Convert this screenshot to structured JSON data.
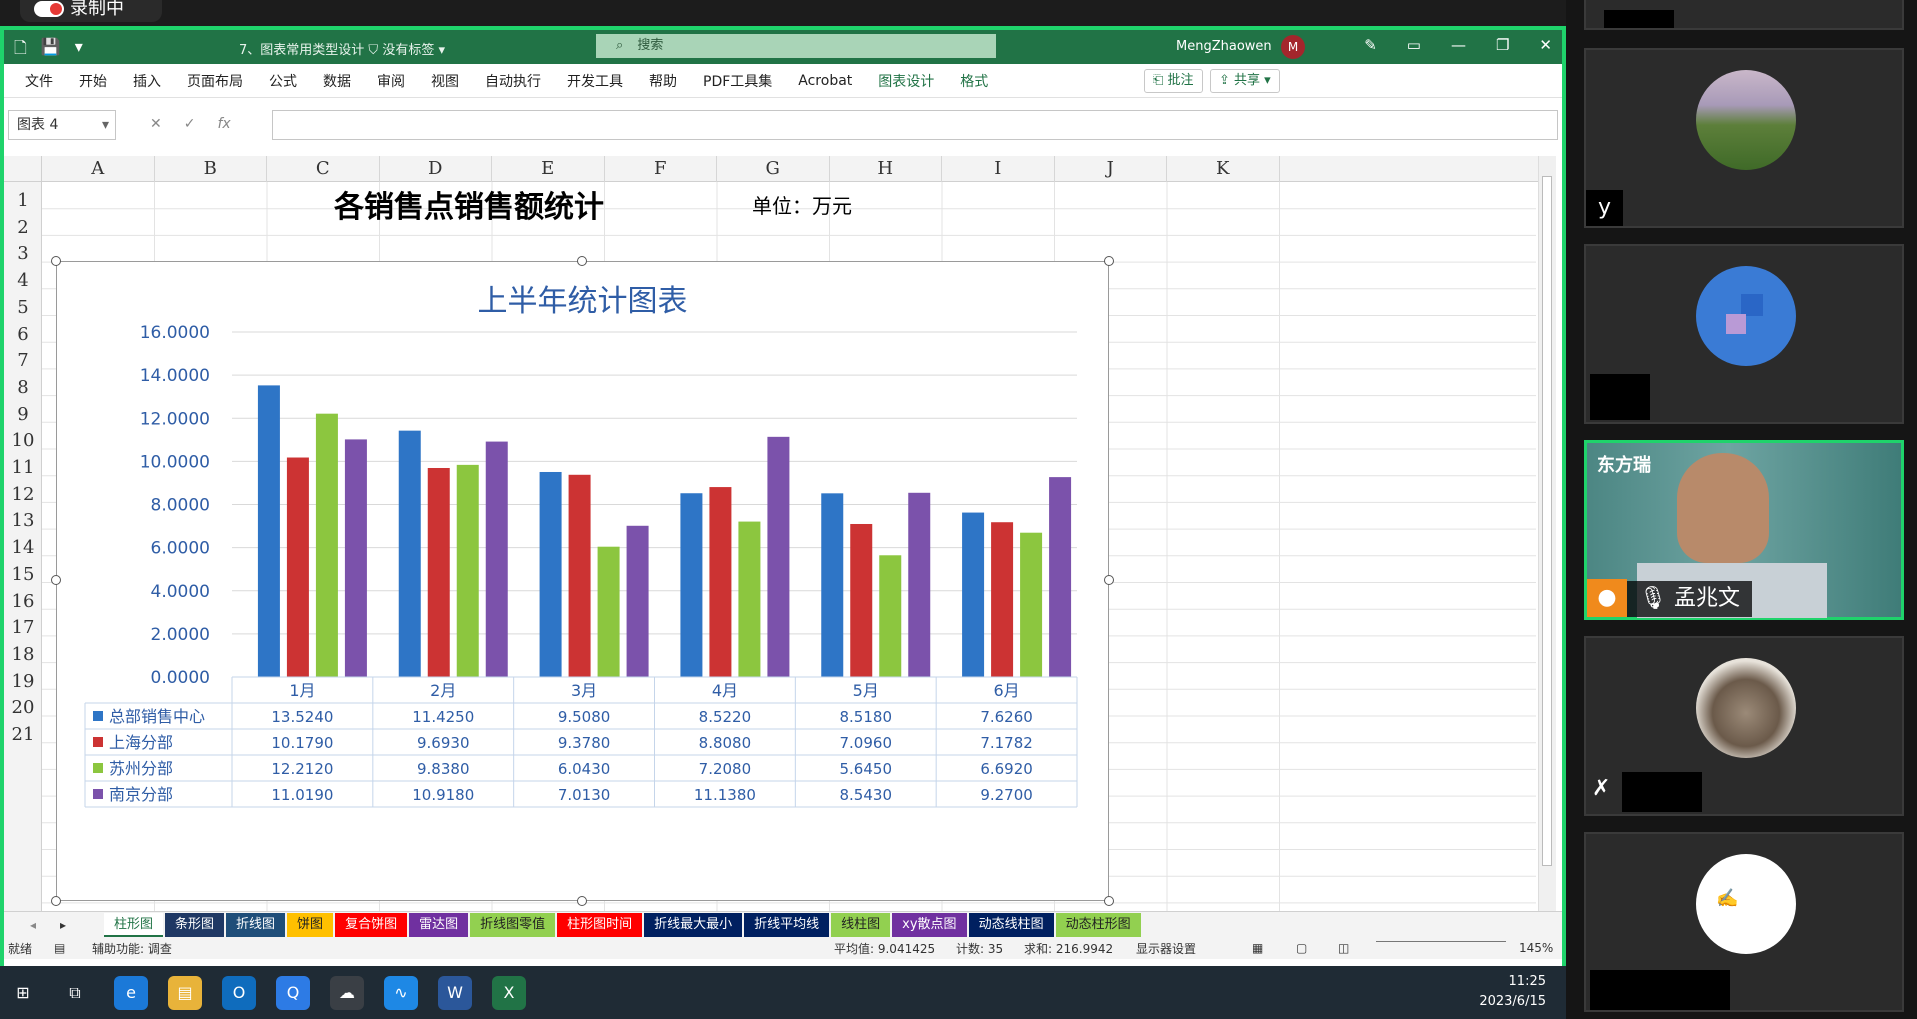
{
  "recording": {
    "label": "录制中"
  },
  "excel": {
    "doc_title": "7、图表常用类型设计",
    "label_status": "没有标签",
    "search_placeholder": "搜索",
    "user_name": "MengZhaowen",
    "user_initial": "M",
    "ribbon_tabs": [
      "文件",
      "开始",
      "插入",
      "页面布局",
      "公式",
      "数据",
      "审阅",
      "视图",
      "自动执行",
      "开发工具",
      "帮助",
      "PDF工具集",
      "Acrobat",
      "图表设计",
      "格式"
    ],
    "comment_btn": "批注",
    "share_btn": "共享",
    "name_box": "图表 4",
    "fx_label": "fx",
    "columns": [
      "A",
      "B",
      "C",
      "D",
      "E",
      "F",
      "G",
      "H",
      "I",
      "J",
      "K"
    ],
    "rows": [
      "1",
      "2",
      "3",
      "4",
      "5",
      "6",
      "7",
      "8",
      "9",
      "10",
      "11",
      "12",
      "13",
      "14",
      "15",
      "16",
      "17",
      "18",
      "19",
      "20",
      "21"
    ],
    "sheet_title": "各销售点销售额统计",
    "unit_label": "单位：万元",
    "sheet_tabs": [
      {
        "label": "柱形图",
        "color": "#ffffff"
      },
      {
        "label": "条形图",
        "color": "#1f3864"
      },
      {
        "label": "折线图",
        "color": "#1f4e79"
      },
      {
        "label": "饼图",
        "color": "#ffc000"
      },
      {
        "label": "复合饼图",
        "color": "#ff0000"
      },
      {
        "label": "雷达图",
        "color": "#7030a0"
      },
      {
        "label": "折线图零值",
        "color": "#92d050"
      },
      {
        "label": "柱形图时间",
        "color": "#ff0000"
      },
      {
        "label": "折线最大最小",
        "color": "#002060"
      },
      {
        "label": "折线平均线",
        "color": "#002060"
      },
      {
        "label": "线柱图",
        "color": "#92d050"
      },
      {
        "label": "xy散点图",
        "color": "#7030a0"
      },
      {
        "label": "动态线柱图",
        "color": "#002060"
      },
      {
        "label": "动态柱形图",
        "color": "#92d050"
      }
    ],
    "status": {
      "ready": "就绪",
      "accessibility": "辅助功能: 调查",
      "average": "平均值: 9.041425",
      "count": "计数: 35",
      "sum": "求和: 216.9942",
      "display_settings": "显示器设置",
      "zoom": "145%"
    }
  },
  "chart_data": {
    "type": "bar",
    "title": "上半年统计图表",
    "categories": [
      "1月",
      "2月",
      "3月",
      "4月",
      "5月",
      "6月"
    ],
    "ylim": [
      0,
      16
    ],
    "yticks": [
      "0.0000",
      "2.0000",
      "4.0000",
      "6.0000",
      "8.0000",
      "10.0000",
      "12.0000",
      "14.0000",
      "16.0000"
    ],
    "series": [
      {
        "name": "总部销售中心",
        "color": "#2e75c6",
        "values": [
          13.524,
          11.425,
          9.508,
          8.522,
          8.518,
          7.626
        ],
        "labels": [
          "13.5240",
          "11.4250",
          "9.5080",
          "8.5220",
          "8.5180",
          "7.6260"
        ]
      },
      {
        "name": "上海分部",
        "color": "#cc3333",
        "values": [
          10.179,
          9.693,
          9.378,
          8.808,
          7.096,
          7.1782
        ],
        "labels": [
          "10.1790",
          "9.6930",
          "9.3780",
          "8.8080",
          "7.0960",
          "7.1782"
        ]
      },
      {
        "name": "苏州分部",
        "color": "#8cc63f",
        "values": [
          12.212,
          9.838,
          6.043,
          7.208,
          5.645,
          6.692
        ],
        "labels": [
          "12.2120",
          "9.8380",
          "6.0430",
          "7.2080",
          "5.6450",
          "6.6920"
        ]
      },
      {
        "name": "南京分部",
        "color": "#7b52ab",
        "values": [
          11.019,
          10.918,
          7.013,
          11.138,
          8.543,
          9.27
        ],
        "labels": [
          "11.0190",
          "10.9180",
          "7.0130",
          "11.1380",
          "8.5430",
          "9.2700"
        ]
      }
    ],
    "legend": "data-table"
  },
  "taskbar": {
    "time": "11:25",
    "date": "2023/6/15"
  },
  "meeting": {
    "participants": [
      {
        "name": "y",
        "active": false
      },
      {
        "name": "",
        "active": false
      },
      {
        "name": "孟兆文",
        "active": true,
        "banner": "东方瑞"
      },
      {
        "name": "",
        "active": false
      },
      {
        "name": "",
        "active": false
      }
    ]
  }
}
